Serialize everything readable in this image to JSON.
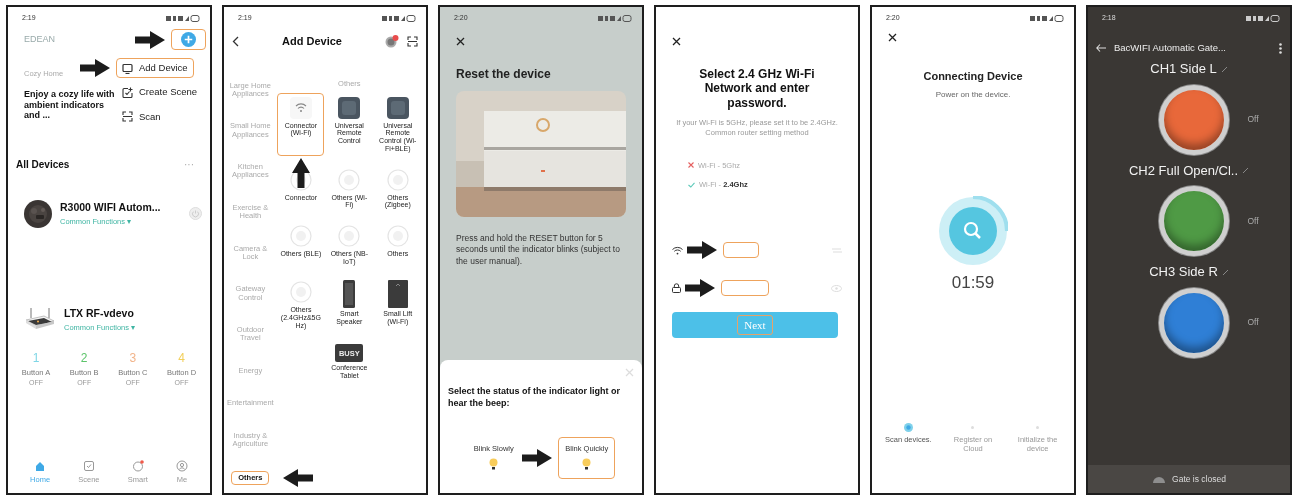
{
  "panels": [
    {
      "kind": "home",
      "status_time": "2:19",
      "brand": "EDEAN",
      "add_button": {
        "highlighted": true,
        "pointed": true
      },
      "menu": [
        {
          "label": "Add Device",
          "kind": "device",
          "highlighted": true,
          "pointed": true
        },
        {
          "label": "Create Scene",
          "kind": "scene",
          "highlighted": false
        },
        {
          "label": "Scan",
          "kind": "scan",
          "highlighted": false
        }
      ],
      "home_label": "Cozy Home",
      "promo": "Enjoy a cozy life with ambient indicators and ...",
      "section_title": "All Devices",
      "more": "···",
      "devices": [
        {
          "name": "R3000 WIFI Autom...",
          "subtitle": "Common Functions ▾",
          "action_icon": true
        },
        {
          "name": "LTX RF-vdevo",
          "subtitle": "Common Functions ▾",
          "buttons": [
            {
              "number": "1",
              "label": "Button A",
              "state": "OFF",
              "color": "#7fd6e6"
            },
            {
              "number": "2",
              "label": "Button B",
              "state": "OFF",
              "color": "#5cc46a"
            },
            {
              "number": "3",
              "label": "Button C",
              "state": "OFF",
              "color": "#f2b48a"
            },
            {
              "number": "4",
              "label": "Button D",
              "state": "OFF",
              "color": "#f2cf5a"
            }
          ]
        }
      ],
      "tabs": [
        {
          "label": "Home",
          "selected": true
        },
        {
          "label": "Scene",
          "selected": false
        },
        {
          "label": "Smart",
          "selected": false
        },
        {
          "label": "Me",
          "selected": false
        }
      ]
    },
    {
      "kind": "catalog",
      "status_time": "2:19",
      "title": "Add Device",
      "notification_badge": true,
      "categories": [
        {
          "label": "Large Home Appliances",
          "selected": false,
          "highlighted": false
        },
        {
          "label": "Small Home Appliances",
          "selected": false,
          "highlighted": false
        },
        {
          "label": "Kitchen Appliances",
          "selected": false,
          "highlighted": false
        },
        {
          "label": "Exercise & Health",
          "selected": false,
          "highlighted": false
        },
        {
          "label": "Camera & Lock",
          "selected": false,
          "highlighted": false
        },
        {
          "label": "Gateway Control",
          "selected": false,
          "highlighted": false
        },
        {
          "label": "Outdoor Travel",
          "selected": false,
          "highlighted": false
        },
        {
          "label": "Energy",
          "selected": false,
          "highlighted": false
        },
        {
          "label": "Entertainment",
          "selected": false,
          "highlighted": false
        },
        {
          "label": "Industry & Agriculture",
          "selected": false,
          "highlighted": false
        },
        {
          "label": "Others",
          "selected": true,
          "highlighted": true,
          "pointed": true
        }
      ],
      "group_title": "Others",
      "devices": [
        {
          "label": "Connector (Wi-Fi)",
          "kind": "wifi",
          "highlighted": true,
          "pointed": true
        },
        {
          "label": "Universal Remote Control",
          "kind": "remote",
          "highlighted": false
        },
        {
          "label": "Universal Remote Control (Wi-Fi+BLE)",
          "kind": "remote",
          "highlighted": false
        },
        {
          "label": "Connector",
          "kind": "faint",
          "highlighted": false
        },
        {
          "label": "Others (Wi-Fi)",
          "kind": "faint",
          "highlighted": false
        },
        {
          "label": "Others (Zigbee)",
          "kind": "faint",
          "highlighted": false
        },
        {
          "label": "Others (BLE)",
          "kind": "faint",
          "highlighted": false
        },
        {
          "label": "Others (NB-IoT)",
          "kind": "faint",
          "highlighted": false
        },
        {
          "label": "Others",
          "kind": "faint",
          "highlighted": false
        },
        {
          "label": "Others (2.4GHz&5G Hz)",
          "kind": "faint",
          "highlighted": false
        },
        {
          "label": "Smart Speaker",
          "kind": "speaker",
          "highlighted": false
        },
        {
          "label": "Small Lift (Wi-Fi)",
          "kind": "lift",
          "highlighted": false
        },
        {
          "label": "Conference Tablet",
          "kind": "busy",
          "tile_text": "BUSY",
          "highlighted": false
        }
      ]
    },
    {
      "kind": "reset",
      "status_time": "2:20",
      "dimmed": true,
      "title": "Reset the device",
      "instruction": "Press and hold the RESET button for 5 seconds until the indicator blinks (subject to the user manual).",
      "sheet": {
        "prompt": "Select the status of the indicator light or hear the beep:",
        "options": [
          {
            "label": "Blink Slowly",
            "highlighted": false
          },
          {
            "label": "Blink Quickly",
            "highlighted": true,
            "pointed": true
          }
        ]
      }
    },
    {
      "kind": "wifi",
      "title": "Select 2.4 GHz Wi-Fi Network and enter password.",
      "hint": "If your Wi-Fi is 5GHz, please set it to be 2.4GHz.",
      "hint_link": "Common router setting method",
      "networks": [
        {
          "label": "Wi-Fi - 5Ghz",
          "ok": false
        },
        {
          "label": "Wi-Fi - **2.4Ghz**",
          "ok": true
        }
      ],
      "fields": [
        {
          "kind": "wifi",
          "highlighted": true,
          "pointed": true
        },
        {
          "kind": "password",
          "highlighted": true,
          "pointed": true
        }
      ],
      "next": {
        "label": "Next",
        "highlighted": true
      }
    },
    {
      "kind": "connecting",
      "status_time": "2:20",
      "title": "Connecting Device",
      "subtitle": "Power on the device.",
      "countdown": "01:59",
      "steps": [
        {
          "label": "Scan devices.",
          "selected": true
        },
        {
          "label": "Register on Cloud",
          "selected": false
        },
        {
          "label": "Initialize the device",
          "selected": false
        }
      ]
    },
    {
      "kind": "gate",
      "status_time": "2:18",
      "title": "BacWIFI Automatic Gate...",
      "channels": [
        {
          "name": "CH1 Side L",
          "color": "#e8683a",
          "state": "Off"
        },
        {
          "name": "CH2 Full Open/Cl..",
          "color": "#4f9a45",
          "state": "Off"
        },
        {
          "name": "CH3 Side R",
          "color": "#2f7fd6",
          "state": "Off"
        }
      ],
      "footer": "Gate is closed"
    }
  ]
}
